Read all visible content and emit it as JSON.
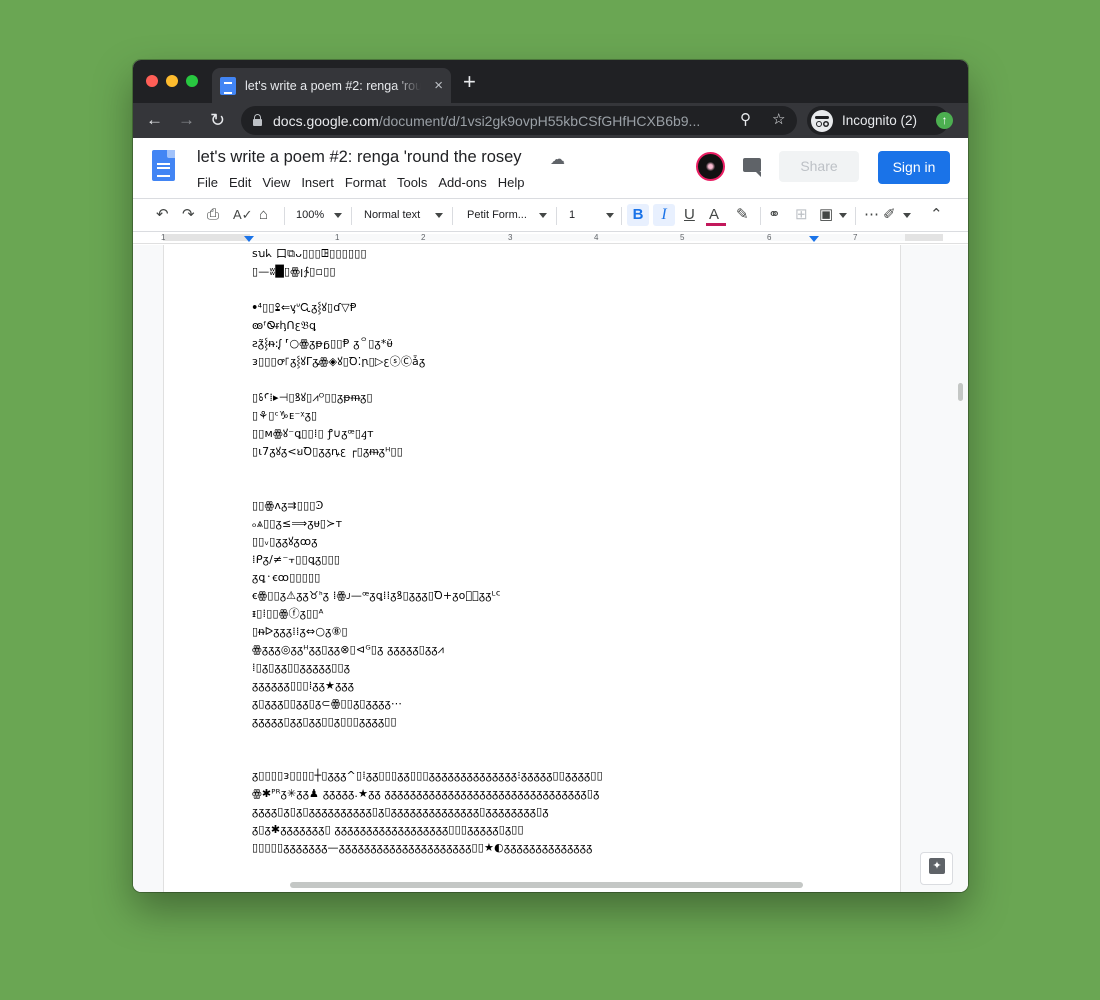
{
  "browser": {
    "tab_title": "let's write a poem #2: renga 'round the rosey",
    "tab_close": "×",
    "new_tab": "+",
    "url_host": "docs.google.com",
    "url_path": "/document/d/1vsi2gk9ovpH55kbCSfGHfHCXB6b9...",
    "profile_label": "Incognito (2)",
    "update_icon": "↑"
  },
  "docs": {
    "title": "let's write a poem #2: renga 'round the rosey",
    "menu": [
      "File",
      "Edit",
      "View",
      "Insert",
      "Format",
      "Tools",
      "Add-ons",
      "Help"
    ],
    "share_label": "Share",
    "signin_label": "Sign in"
  },
  "toolbar": {
    "zoom": "100%",
    "style": "Normal text",
    "font": "Petit Form...",
    "size": "1",
    "bold": "B",
    "italic": "I",
    "underline": "U",
    "text_color": "A"
  },
  "ruler": {
    "numbers": [
      "1",
      "1",
      "2",
      "3",
      "4",
      "5",
      "6",
      "7"
    ]
  },
  "poem": {
    "stanza1": [
      "ꜱꭒᖾ  ⼝⧉ᴗ▯▯▯ꖸ▯▯▯▯▯▯",
      "▯—ʬ█▯ꙮꞁ∱▯▫▯▯"
    ],
    "stanza2": [
      "ꔷ⁴▯▯ꔍ⇐ᶌᐡᏩᵹ⸾ꙋ▯ɗ▽Ᵽ",
      "ꙭᶠᏫᵲꞕᑎꜫ𝔅ꝗ",
      "ꙅᵹ̃⸾ᵰ꞉ᶘ ⸢○ꙮᵹᵽᵷ▯▯Ᵽ ᵹ꒪▯ᵹ*ᵾ̌",
      "ᴈ▯▯▯ꝍ꜒ᵹ⸾ꙋᒥᵹ꜡ꙮ◈ꙋ▯Ꝺ⁚ꞃ▯▷ꜫⓢⒸǡᵹ"
    ],
    "stanza3": [
      "▯ꗏꜤ⁞▸⊣▯ꝸꙋ▯⩘ᴼ▯▯ᵹᵽᵯᵹ▯",
      "▯⚘▯ᶜ♑ᴇ⁻ᵡᵹ▯",
      "▯▯ᴍꙮꙋ⁻ꝗ▯▯⁞▯ ꝭ∪ᵹꟹ▯ꜭᴛ",
      "▯ꙇ7ᵹꙋᵹ<ꞟꝹ▯ᵹᵹꝴꜫ ┌▯ᵹᵯᵹᵸ▯▯"
    ],
    "stanza4": [
      "▯▯ꙮᴧᵹ⇉▯▯▯Ͽ",
      "ₒ⩓▯▯ᵹ≤⟹ᵹᵾ▯≻ᴛ",
      "▯▯ᵥ▯ᵹᵹꙋᵹꝏᵹ",
      "⁞ᑭᵹ/≠⁻⫟▯▯ꝗᵹ▯▯▯",
      "ᵹꝗ᛫ꞓꝏ▯▯▯▯▯",
      "ꞓꙮ▯▯ᵹ⚠ᵹᵹ♉ᑋᵹ  ⁞ꙮᴊ—ꟹᵹꝗ⁞⁞ᵹꝸ▯ᵹᵹᵹ▯Ꝺ+ᵹᴏᵹ⃝ᵹᵹᴸᑦ",
      "ᵻ▯⁞▯▯ꙮⓕᵹ▯▯ᴬ",
      "▯ᵰᐅᵹᵹᵹ⁞⁞ᵹ⇔○ᵹ⑧▯",
      "ꙮᵹᵹᵹ◎ᵹᵹᴴᵹᵹ▯ᵹᵹ⊗▯⊲ᴳ▯ᵹ  ᵹᵹᵹᵹᵹ▯ᵹᵹ⩘",
      "⁞▯ᵹ▯ᵹᵹ▯▯ᵹᵹᵹᵹᵹ▯▯ᵹ",
      "ᵹᵹᵹᵹᵹᵹ▯▯▯⁞ᵹᵹ★ᵹᵹᵹ",
      "ᵹ▯ᵹᵹᵹ▯▯ᵹᵹ▯ᵹ⊂ꙮ▯▯ᵹ▯ᵹᵹᵹᵹ⋯",
      "ᵹᵹᵹᵹᵹ▯ᵹᵹ▯ᵹᵹ▯▯ᵹ▯▯▯ᵹᵹᵹᵹ▯▯"
    ],
    "stanza5": [
      "ᵹ▯▯▯▯ᴈ▯▯▯▯┼▯ᵹᵹᵹ^▯⁞ᵹᵹ▯▯▯ᵹᵹ▯▯▯ᵹᵹᵹᵹᵹᵹᵹᵹᵹᵹᵹᵹᵹᵹ⁝ᵹᵹᵹᵹᵹ▯▯ᵹᵹᵹᵹ▯▯",
      "ꙮ✱ᴾᴿᵹ✳ᵹᵹ♟ ᵹᵹᵹᵹᵹ.★ᵹᵹ ᵹᵹᵹᵹᵹᵹᵹᵹᵹᵹᵹᵹᵹᵹᵹᵹᵹᵹᵹᵹᵹᵹᵹᵹᵹᵹᵹᵹᵹᵹᵹᵹ▯ᵹ",
      "ᵹᵹᵹᵹ▯ᵹ▯ᵹ▯ᵹᵹᵹᵹᵹᵹᵹᵹᵹᵹ▯ᵹ▯ᵹᵹᵹᵹᵹᵹᵹᵹᵹᵹᵹᵹᵹᵹ▯ᵹᵹᵹᵹᵹᵹᵹᵹ▯ᵹ",
      "ᵹ▯ᵹ✱ᵹᵹᵹᵹᵹᵹᵹ▯  ᵹᵹᵹᵹᵹᵹᵹᵹᵹᵹᵹᵹᵹᵹᵹᵹᵹᵹ▯▯▯ᵹᵹᵹᵹᵹ▯ᵹ▯▯",
      "▯▯▯▯▯ᵹᵹᵹᵹᵹᵹᵹ—ᵹᵹᵹᵹᵹᵹᵹᵹᵹᵹᵹᵹᵹᵹᵹᵹᵹᵹᵹᵹᵹ▯▯★◐ᵹᵹᵹᵹᵹᵹᵹᵹᵹᵹᵹᵹᵹᵹ"
    ]
  }
}
